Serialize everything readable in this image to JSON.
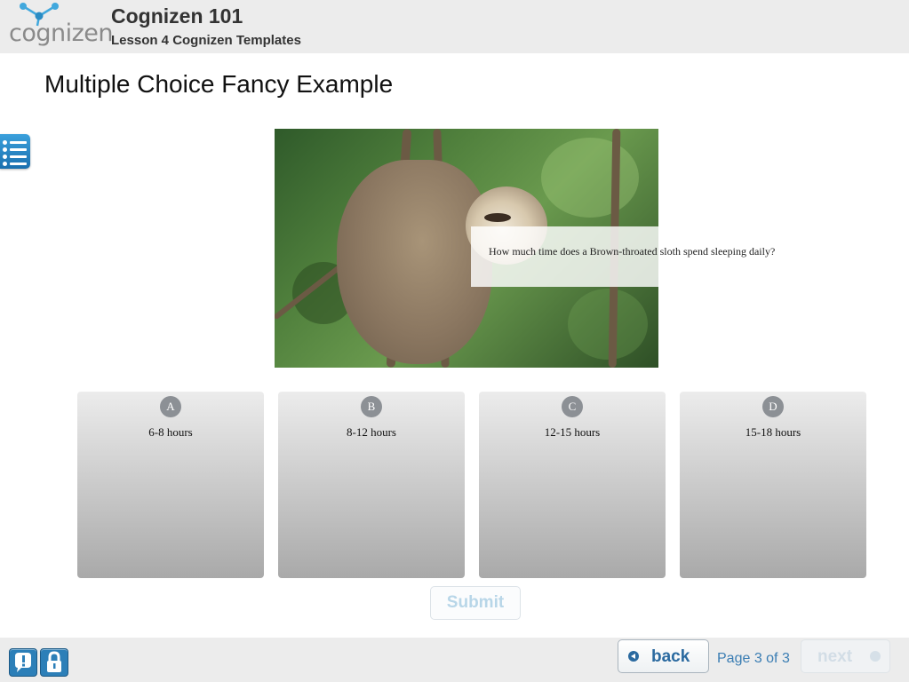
{
  "header": {
    "logo_text": "cognizen",
    "course_title": "Cognizen 101",
    "lesson_title": "Lesson 4 Cognizen Templates"
  },
  "page": {
    "title": "Multiple Choice Fancy Example",
    "question": "How much time does a Brown-throated sloth spend sleeping daily?"
  },
  "choices": [
    {
      "letter": "A",
      "answer": "6-8 hours"
    },
    {
      "letter": "B",
      "answer": "8-12 hours"
    },
    {
      "letter": "C",
      "answer": "12-15 hours"
    },
    {
      "letter": "D",
      "answer": "15-18 hours"
    }
  ],
  "submit_label": "Submit",
  "footer": {
    "back_label": "back",
    "page_indicator": "Page 3 of 3",
    "next_label": "next",
    "icons": [
      "help-icon",
      "lock-icon"
    ]
  },
  "colors": {
    "accent": "#2c7fb8",
    "header_bg": "#ececec",
    "choice_badge": "#8c9095"
  }
}
